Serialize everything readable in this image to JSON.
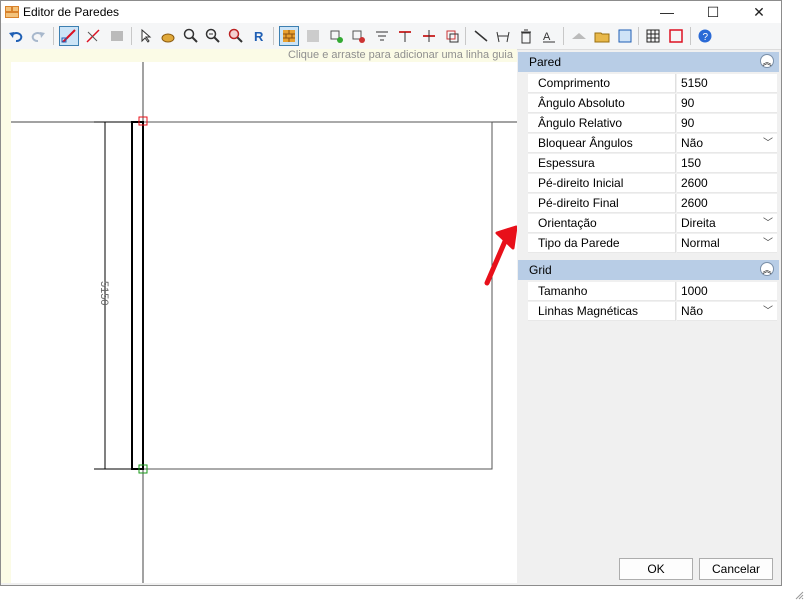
{
  "window": {
    "title": "Editor de Paredes",
    "minimize": "—",
    "maximize": "☐",
    "close": "✕"
  },
  "canvas": {
    "hint": "Clique e arraste para adicionar uma linha guia",
    "dimension": "5150"
  },
  "panel": {
    "categories": [
      {
        "name": "Pared",
        "rows": [
          {
            "label": "Comprimento",
            "value": "5150"
          },
          {
            "label": "Ângulo Absoluto",
            "value": "90"
          },
          {
            "label": "Ângulo Relativo",
            "value": "90"
          },
          {
            "label": "Bloquear Ângulos",
            "value": "Não"
          },
          {
            "label": "Espessura",
            "value": "150"
          },
          {
            "label": "Pé-direito Inicial",
            "value": "2600"
          },
          {
            "label": "Pé-direito Final",
            "value": "2600"
          },
          {
            "label": "Orientação",
            "value": "Direita"
          },
          {
            "label": "Tipo da Parede",
            "value": "Normal"
          }
        ]
      },
      {
        "name": "Grid",
        "rows": [
          {
            "label": "Tamanho",
            "value": "1000"
          },
          {
            "label": "Linhas Magnéticas",
            "value": "Não"
          }
        ]
      }
    ]
  },
  "buttons": {
    "ok": "OK",
    "cancel": "Cancelar"
  },
  "colors": {
    "accent": "#e8101a",
    "category_bg": "#b8cde6",
    "hint_bg": "#fbfbe6"
  }
}
